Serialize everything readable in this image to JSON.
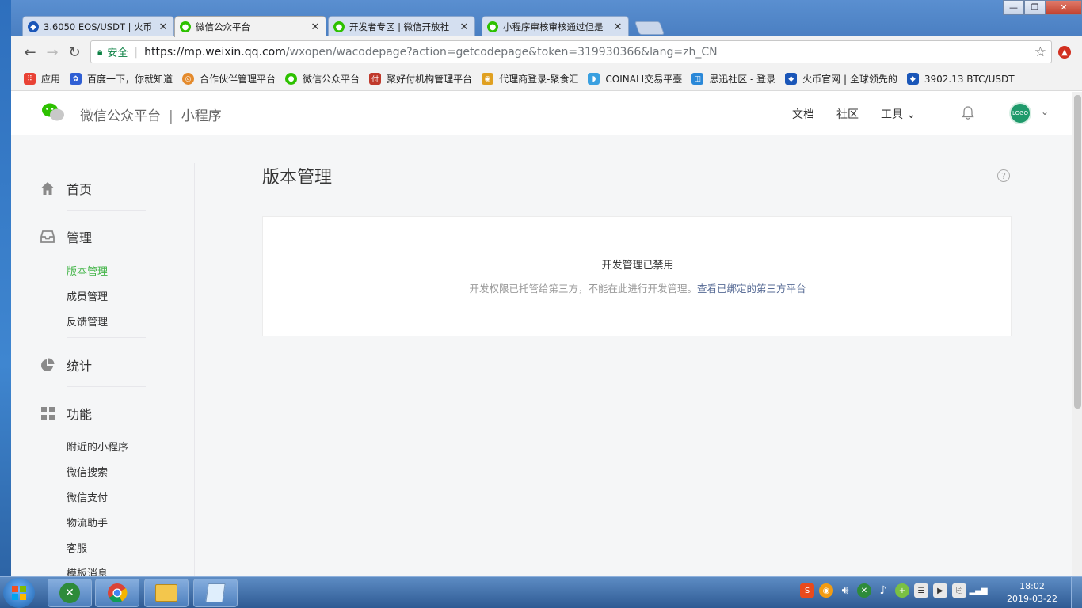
{
  "browser": {
    "tabs": [
      {
        "title": "3.6050 EOS/USDT | 火币",
        "close": "✕",
        "color": "#1a56b8"
      },
      {
        "title": "微信公众平台",
        "close": "✕",
        "color": "#2dc100"
      },
      {
        "title": "开发者专区 | 微信开放社",
        "close": "✕",
        "color": "#2dc100"
      },
      {
        "title": "小程序审核审核通过但是",
        "close": "✕",
        "color": "#2dc100"
      }
    ],
    "active_tab": 1,
    "secure_label": "安全",
    "url_scheme_host": "https://mp.weixin.qq.com",
    "url_rest": "/wxopen/wacodepage?action=getcodepage&token=319930366&lang=zh_CN",
    "bookmarks": [
      {
        "label": "应用",
        "icon": "apps-grid-icon",
        "color": "#e94235"
      },
      {
        "label": "百度一下，你就知道",
        "icon": "baidu-paw-icon",
        "color": "#2f5fd4"
      },
      {
        "label": "合作伙伴管理平台",
        "icon": "partner-icon",
        "color": "#e48a2c"
      },
      {
        "label": "微信公众平台",
        "icon": "wechat-icon",
        "color": "#2dc100"
      },
      {
        "label": "聚好付机构管理平台",
        "icon": "pay-icon",
        "color": "#c0392b"
      },
      {
        "label": "代理商登录-聚食汇",
        "icon": "agent-icon",
        "color": "#e0a020"
      },
      {
        "label": "COINALI交易平臺",
        "icon": "coinali-icon",
        "color": "#3aa0e0"
      },
      {
        "label": "思迅社区 - 登录",
        "icon": "sixun-icon",
        "color": "#2a88d8"
      },
      {
        "label": "火币官网 | 全球领先的",
        "icon": "huobi-icon",
        "color": "#1a56b8"
      },
      {
        "label": "3902.13 BTC/USDT",
        "icon": "huobi-icon",
        "color": "#1a56b8"
      }
    ]
  },
  "header": {
    "brand": "微信公众平台",
    "divider": "|",
    "product": "小程序",
    "links": [
      "文档",
      "社区",
      "工具 ⌄"
    ],
    "avatar_text": "LOGO",
    "chevron": "⌄"
  },
  "sidebar": {
    "groups": [
      {
        "label": "首页",
        "icon": "home-icon"
      },
      {
        "label": "管理",
        "icon": "inbox-icon"
      },
      {
        "label": "统计",
        "icon": "pie-chart-icon"
      },
      {
        "label": "功能",
        "icon": "grid-icon"
      }
    ],
    "manage_items": [
      "版本管理",
      "成员管理",
      "反馈管理"
    ],
    "feature_items": [
      "附近的小程序",
      "微信搜索",
      "微信支付",
      "物流助手",
      "客服",
      "模板消息"
    ],
    "active_item": "版本管理"
  },
  "main": {
    "title": "版本管理",
    "help": "?",
    "notice_title": "开发管理已禁用",
    "notice_desc": "开发权限已托管给第三方，不能在此进行开发管理。",
    "notice_link": "查看已绑定的第三方平台"
  },
  "taskbar": {
    "time": "18:02",
    "date": "2019-03-22"
  },
  "colors": {
    "accent_green": "#44b549",
    "link_blue": "#576b95"
  }
}
